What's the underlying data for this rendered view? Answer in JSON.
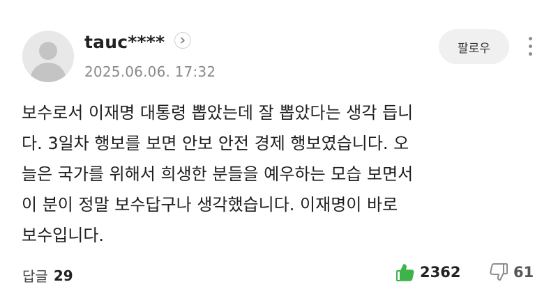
{
  "comment": {
    "username": "tauc****",
    "timestamp": "2025.06.06. 17:32",
    "follow_label": "팔로우",
    "body_lines": [
      "보수로서 이재명 대통령 뽑았는데 잘 뽑았다는 생각 듭니",
      "다. 3일차 행보를 보면 안보 안전 경제 행보였습니다. 오",
      "늘은 국가를 위해서 희생한 분들을 예우하는 모습 보면서",
      "이 분이 정말 보수답구나 생각했습니다. 이재명이 바로",
      "보수입니다."
    ],
    "reply_label": "답글",
    "reply_count": "29",
    "like_count": "2362",
    "dislike_count": "61"
  },
  "colors": {
    "like_green": "#3cb44a",
    "dislike_gray": "#8d8d8d",
    "timestamp_gray": "#8a8a8a",
    "follow_bg": "#f0f0f0"
  },
  "icons": {
    "avatar": "default-user-avatar",
    "profile": "chevron-right-icon",
    "more": "vertical-ellipsis-icon",
    "like": "thumbs-up-icon",
    "dislike": "thumbs-down-icon"
  }
}
